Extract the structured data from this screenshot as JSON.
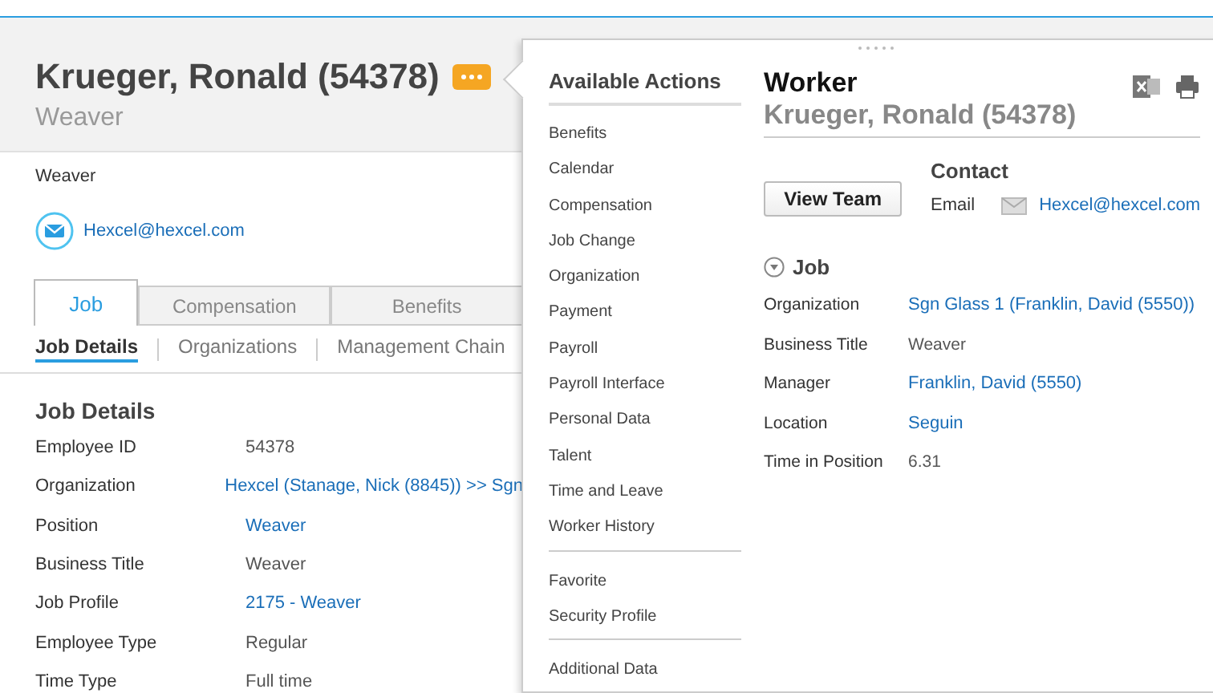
{
  "profile": {
    "name": "Krueger, Ronald (54378)",
    "subtitle": "Weaver",
    "title_line": "Weaver",
    "email": "Hexcel@hexcel.com"
  },
  "tabs": [
    {
      "label": "Job",
      "selected": true
    },
    {
      "label": "Compensation",
      "selected": false
    },
    {
      "label": "Benefits",
      "selected": false
    }
  ],
  "subtabs": [
    {
      "label": "Job Details",
      "selected": true
    },
    {
      "label": "Organizations",
      "selected": false
    },
    {
      "label": "Management Chain",
      "selected": false
    }
  ],
  "job_details": {
    "heading": "Job Details",
    "rows": [
      {
        "label": "Employee ID",
        "value": "54378",
        "link": false
      },
      {
        "label": "Organization",
        "value": "Hexcel (Stanage, Nick (8845)) >> Sgn",
        "link": true
      },
      {
        "label": "Position",
        "value": "Weaver",
        "link": true
      },
      {
        "label": "Business Title",
        "value": "Weaver",
        "link": false
      },
      {
        "label": "Job Profile",
        "value": "2175 - Weaver",
        "link": true
      },
      {
        "label": "Employee Type",
        "value": "Regular",
        "link": false
      },
      {
        "label": "Time Type",
        "value": "Full time",
        "link": false
      }
    ]
  },
  "actions": {
    "heading": "Available Actions",
    "groups": [
      [
        "Benefits",
        "Calendar",
        "Compensation",
        "Job Change",
        "Organization",
        "Payment",
        "Payroll",
        "Payroll Interface",
        "Personal Data",
        "Talent",
        "Time and Leave",
        "Worker History"
      ],
      [
        "Favorite",
        "Security Profile"
      ],
      [
        "Additional Data"
      ]
    ]
  },
  "worker": {
    "heading": "Worker",
    "name": "Krueger, Ronald (54378)",
    "button": "View Team",
    "contact_heading": "Contact",
    "email_label": "Email",
    "email": "Hexcel@hexcel.com",
    "job_heading": "Job",
    "job_expanded": true,
    "rows": [
      {
        "label": "Organization",
        "value": "Sgn Glass 1 (Franklin, David (5550))",
        "link": true
      },
      {
        "label": "Business Title",
        "value": "Weaver",
        "link": false
      },
      {
        "label": "Manager",
        "value": "Franklin, David (5550)",
        "link": true
      },
      {
        "label": "Location",
        "value": " Seguin",
        "link": true
      },
      {
        "label": "Time in Position",
        "value": "6.31",
        "link": false
      }
    ]
  }
}
